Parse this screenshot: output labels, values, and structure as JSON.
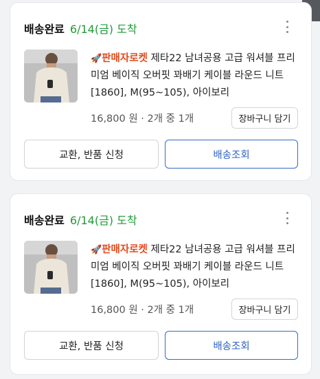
{
  "orders": [
    {
      "status": "배송완료",
      "arrival": "6/14(금) 도착",
      "badge": "판매자로켓",
      "badge_icon": "🚀",
      "product_name": "제타22 남녀공용 고급 워셔블 프리미엄 베이직 오버핏 꽈배기 케이블 라운드 니트 [1860], M(95~105), 아이보리",
      "price": "16,800 원 · 2개 중 1개",
      "cart_label": "장바구니 담기",
      "return_label": "교환, 반품 신청",
      "track_label": "배송조회"
    },
    {
      "status": "배송완료",
      "arrival": "6/14(금) 도착",
      "badge": "판매자로켓",
      "badge_icon": "🚀",
      "product_name": "제타22 남녀공용 고급 워셔블 프리미엄 베이직 오버핏 꽈배기 케이블 라운드 니트 [1860], M(95~105), 아이보리",
      "price": "16,800 원 · 2개 중 1개",
      "cart_label": "장바구니 담기",
      "return_label": "교환, 반품 신청",
      "track_label": "배송조회"
    }
  ],
  "colors": {
    "arrival": "#1e9a38",
    "badge": "#e2491b",
    "track_button": "#3569c6"
  },
  "icons": {
    "more": "more-vertical-icon",
    "badge": "rocket-icon"
  }
}
